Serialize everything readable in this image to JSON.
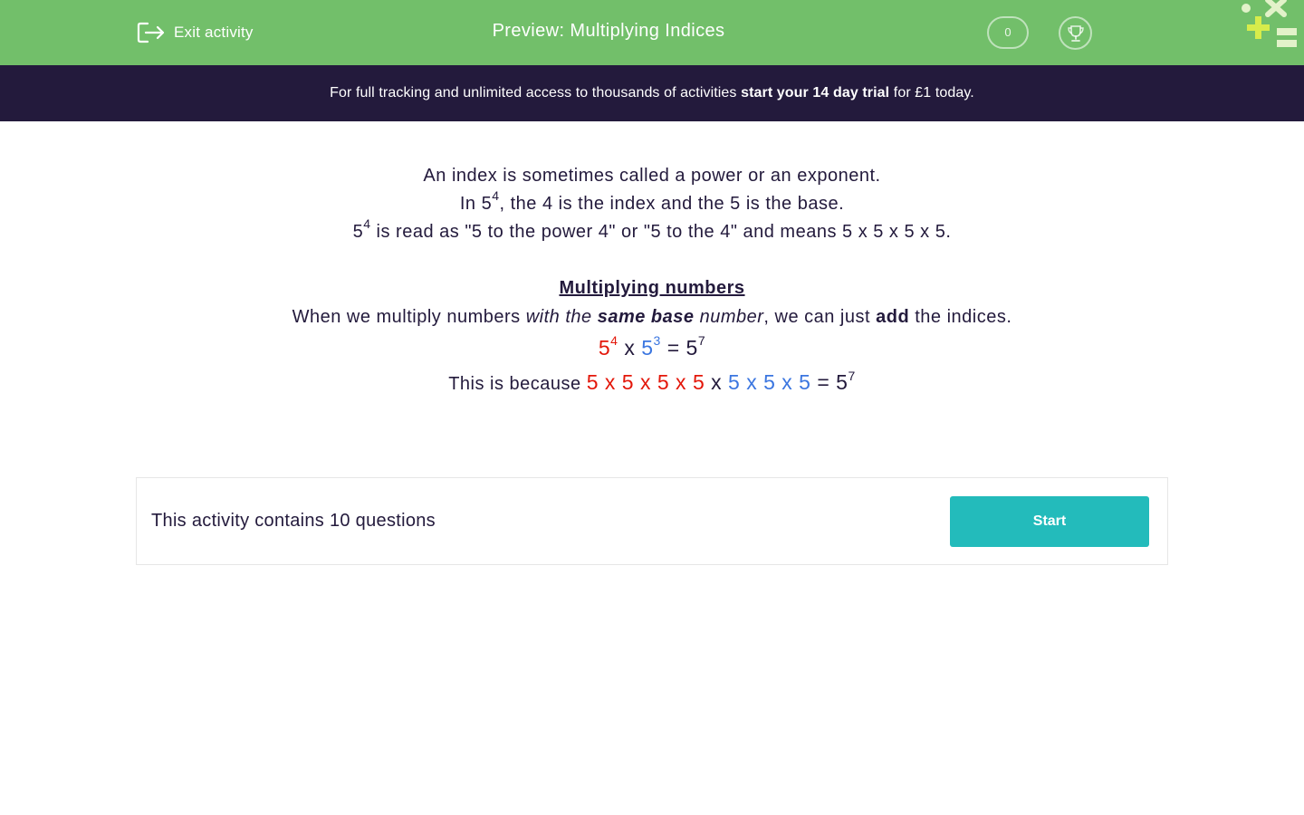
{
  "header": {
    "exit_label": "Exit activity",
    "title": "Preview: Multiplying Indices",
    "score": "0",
    "background_color": "#72bf6a"
  },
  "promo": {
    "text_before": "For full tracking and unlimited access to thousands of activities ",
    "text_bold": "start your 14 day trial",
    "text_after": " for £1 today.",
    "background_color": "#231a3c"
  },
  "lesson": {
    "line1": "An index is sometimes called a power or an exponent.",
    "line2": {
      "a": "In 5",
      "sup": "4",
      "b": ", the 4 is the index and the 5 is the base."
    },
    "line3": {
      "a": "5",
      "sup": "4",
      "b": " is read as \"5 to the power 4\" or \"5 to the 4\" and means 5 x 5 x 5 x 5."
    },
    "heading": "Multiplying numbers",
    "rule": {
      "a": "When we multiply numbers ",
      "b": "with the ",
      "c": "same base",
      "d": " number",
      "e": ", we can just ",
      "f": "add",
      "g": " the indices."
    },
    "example": {
      "base1": "5",
      "exp1": "4",
      "op": " x ",
      "base2": "5",
      "exp2": "3",
      "eq": " = 5",
      "exp_result": "7"
    },
    "because": {
      "intro": "This is because ",
      "red_part": "5 x 5 x 5 x 5",
      "mid": " x ",
      "blue_part": "5 x 5 x 5",
      "eq": " = 5",
      "exp_result": "7"
    },
    "colors": {
      "first_factor": "#e3170a",
      "second_factor": "#3b76e0"
    }
  },
  "activity": {
    "info": "This activity contains 10 questions",
    "start_label": "Start",
    "button_color": "#23bbbb"
  },
  "icons": [
    "exit-icon",
    "trophy-icon",
    "logo-icon"
  ]
}
